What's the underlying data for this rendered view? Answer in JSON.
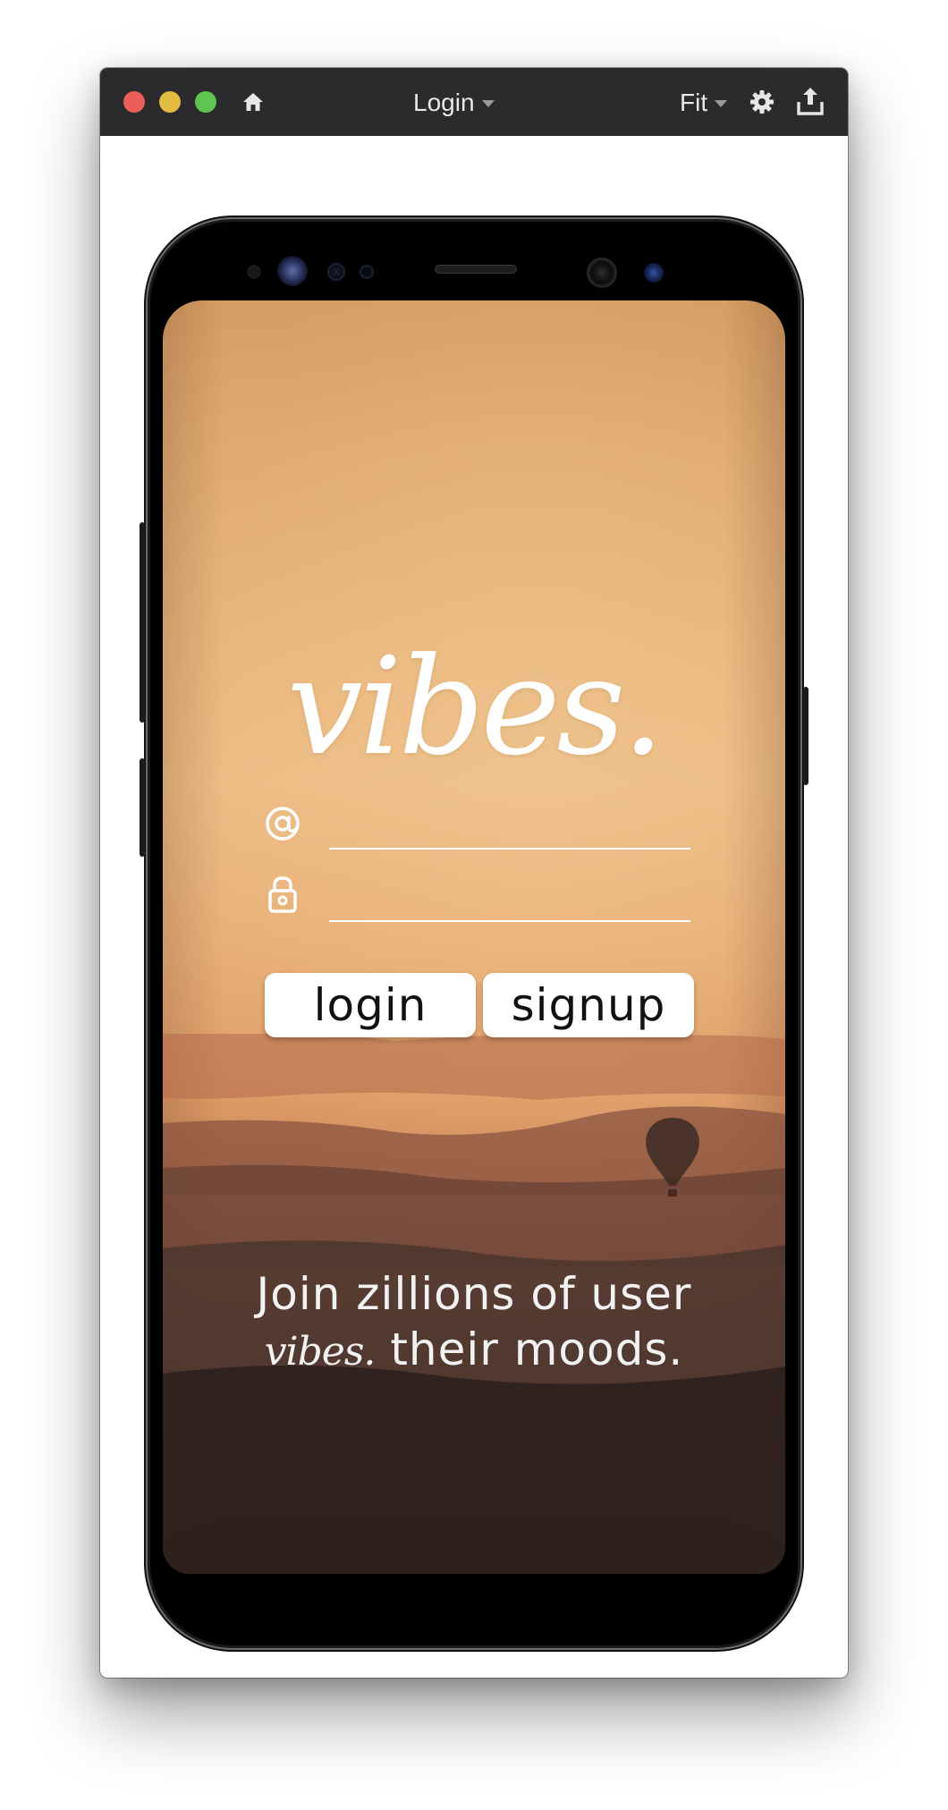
{
  "window": {
    "title": "Login",
    "zoom": "Fit",
    "colors": {
      "titlebar": "#2b2b2d",
      "close": "#ec5f59",
      "minimize": "#e3bd41",
      "maximize": "#60c453"
    },
    "icons": [
      "home-icon",
      "gear-icon",
      "share-icon"
    ]
  },
  "app": {
    "logo": "vibes.",
    "email_field": {
      "icon": "at-icon",
      "value": ""
    },
    "password_field": {
      "icon": "lock-icon",
      "value": ""
    },
    "login_label": "login",
    "signup_label": "signup",
    "tagline_line1": "Join zillions of user",
    "tagline_brand": "vibes.",
    "tagline_line2": "their moods."
  }
}
